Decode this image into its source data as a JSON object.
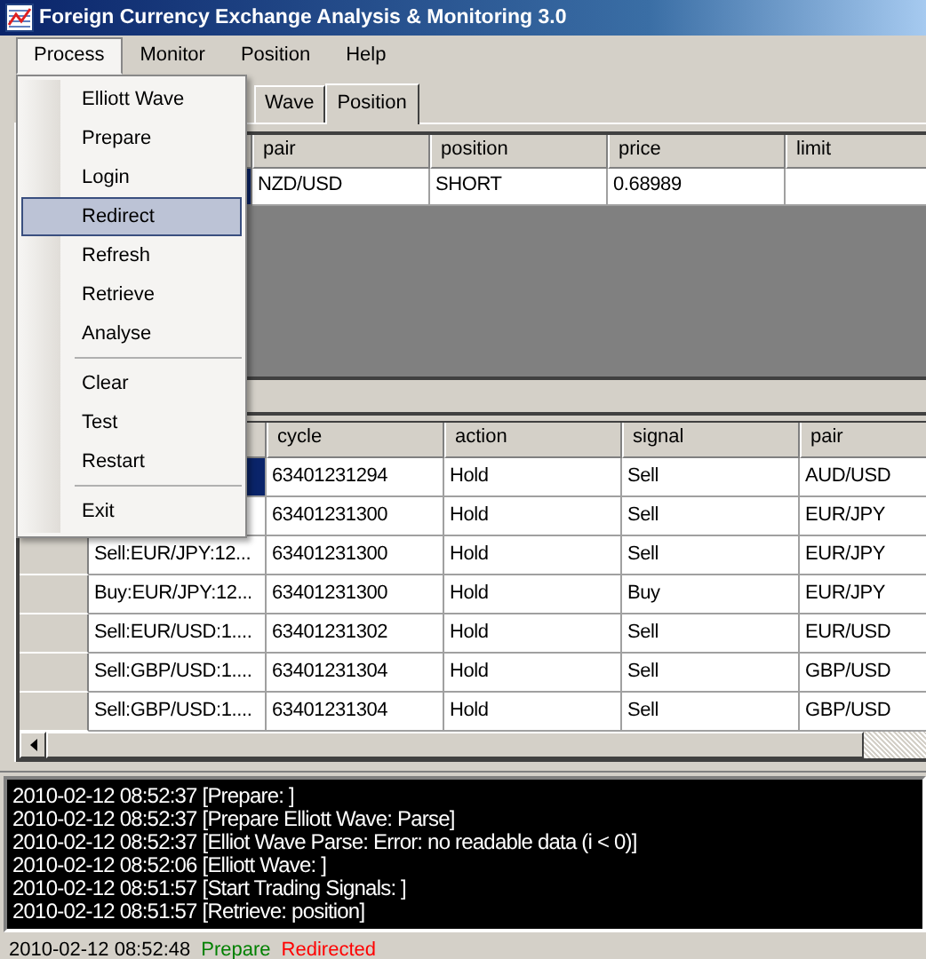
{
  "window": {
    "title": "Foreign Currency Exchange Analysis & Monitoring 3.0"
  },
  "menu_bar": [
    {
      "label": "Process",
      "selected": true
    },
    {
      "label": "Monitor",
      "selected": false
    },
    {
      "label": "Position",
      "selected": false
    },
    {
      "label": "Help",
      "selected": false
    }
  ],
  "process_menu": [
    {
      "kind": "item",
      "label": "Elliott Wave",
      "selected": false
    },
    {
      "kind": "item",
      "label": "Prepare",
      "selected": false
    },
    {
      "kind": "item",
      "label": "Login",
      "selected": false
    },
    {
      "kind": "item",
      "label": "Redirect",
      "selected": true
    },
    {
      "kind": "item",
      "label": "Refresh",
      "selected": false
    },
    {
      "kind": "item",
      "label": "Retrieve",
      "selected": false
    },
    {
      "kind": "item",
      "label": "Analyse",
      "selected": false
    },
    {
      "kind": "separator"
    },
    {
      "kind": "item",
      "label": "Clear",
      "selected": false
    },
    {
      "kind": "item",
      "label": "Test",
      "selected": false
    },
    {
      "kind": "item",
      "label": "Restart",
      "selected": false
    },
    {
      "kind": "separator"
    },
    {
      "kind": "item",
      "label": "Exit",
      "selected": false
    }
  ],
  "tabs": [
    {
      "label": "Wave",
      "selected": false
    },
    {
      "label": "Position",
      "selected": true
    }
  ],
  "positions_table": {
    "columns": [
      "pair",
      "position",
      "price",
      "limit"
    ],
    "rows": [
      {
        "selected": true,
        "cells": [
          "NZD/USD",
          "SHORT",
          "0.68989"
        ]
      }
    ]
  },
  "signals_table": {
    "columns": [
      "cycle",
      "action",
      "signal",
      "pair"
    ],
    "rows": [
      {
        "selected": true,
        "cells": [
          "63401231294",
          "Hold",
          "Sell",
          "AUD/USD"
        ]
      },
      {
        "selected": false,
        "cells": [
          "63401231300",
          "Hold",
          "Sell",
          "EUR/JPY"
        ]
      },
      {
        "selected": false,
        "column_1": "Sell:EUR/JPY:12...",
        "cells": [
          "63401231300",
          "Hold",
          "Sell",
          "EUR/JPY"
        ]
      },
      {
        "selected": false,
        "column_1": "Buy:EUR/JPY:12...",
        "cells": [
          "63401231300",
          "Hold",
          "Buy",
          "EUR/JPY"
        ]
      },
      {
        "selected": false,
        "column_1": "Sell:EUR/USD:1....",
        "cells": [
          "63401231302",
          "Hold",
          "Sell",
          "EUR/USD"
        ]
      },
      {
        "selected": false,
        "column_1": "Sell:GBP/USD:1....",
        "cells": [
          "63401231304",
          "Hold",
          "Sell",
          "GBP/USD"
        ]
      },
      {
        "selected": false,
        "column_1": "Sell:GBP/USD:1....",
        "cells": [
          "63401231304",
          "Hold",
          "Sell",
          "GBP/USD"
        ]
      }
    ]
  },
  "log": [
    "2010-02-12 08:52:37 [Prepare: ]",
    "2010-02-12 08:52:37 [Prepare Elliott Wave: Parse]",
    "2010-02-12 08:52:37 [Elliot Wave Parse: Error: no readable data (i < 0)]",
    "2010-02-12 08:52:06 [Elliott Wave: ]",
    "2010-02-12 08:51:57 [Start Trading Signals: ]",
    "2010-02-12 08:51:57 [Retrieve: position]"
  ],
  "status_bar": [
    {
      "text": "2010-02-12 08:52:48",
      "color": "#000000"
    },
    {
      "text": "Prepare",
      "color": "#008000"
    },
    {
      "text": "Redirected",
      "color": "#ff0000"
    }
  ]
}
